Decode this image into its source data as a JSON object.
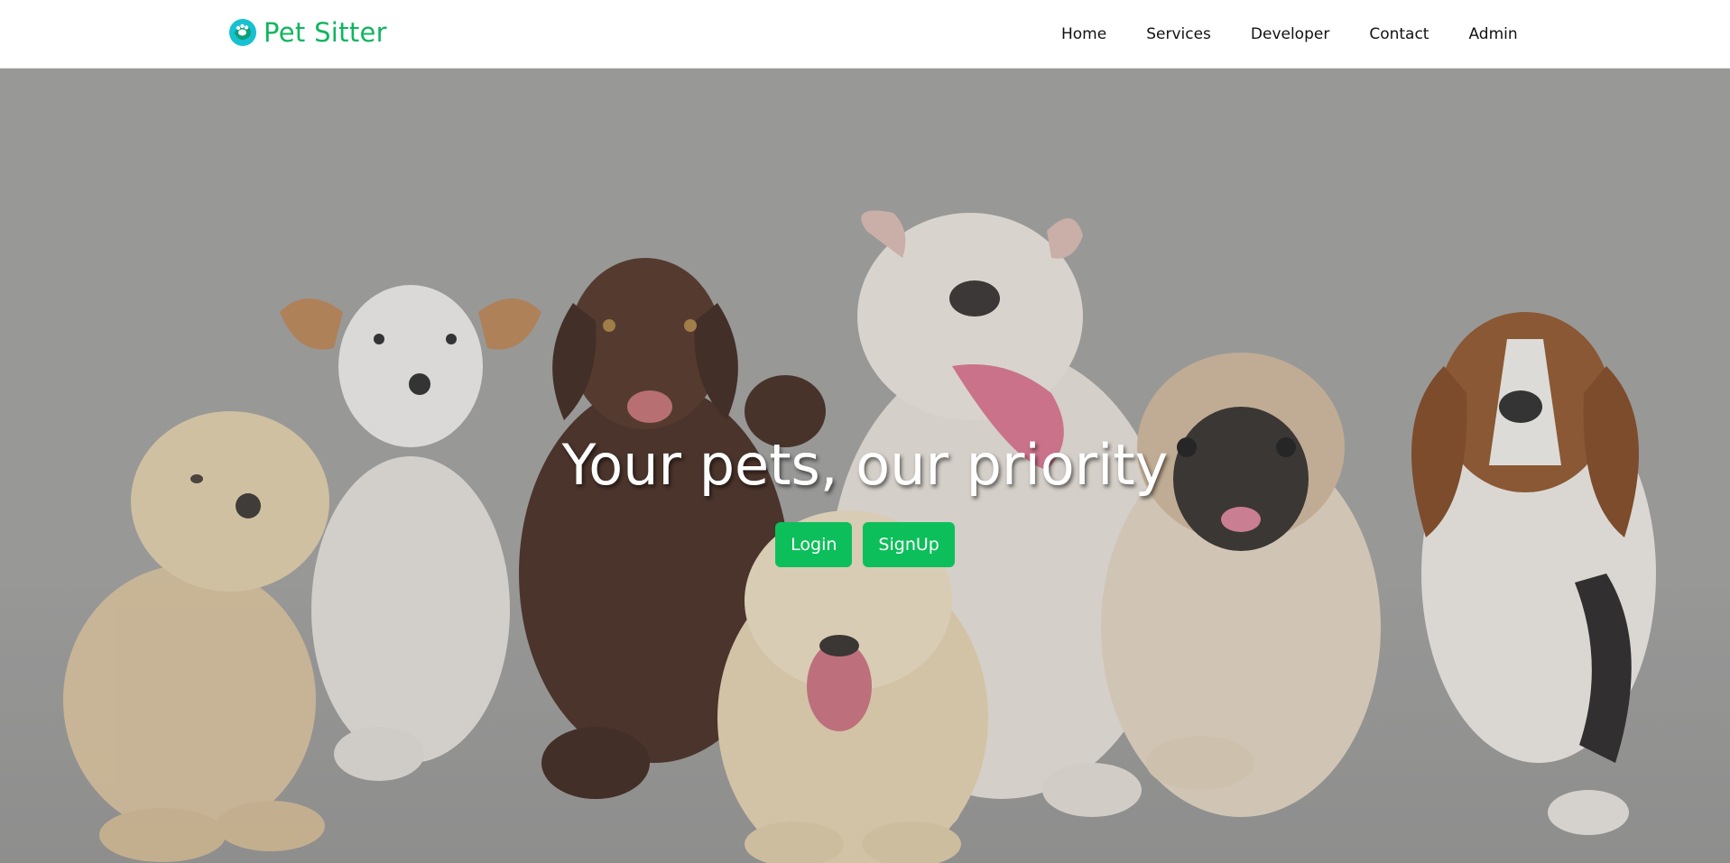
{
  "brand": {
    "name": "Pet Sitter",
    "icon": "paw-heart-icon",
    "color": "#0fb65e"
  },
  "nav": {
    "items": [
      {
        "label": "Home"
      },
      {
        "label": "Services"
      },
      {
        "label": "Developer"
      },
      {
        "label": "Contact"
      },
      {
        "label": "Admin"
      }
    ]
  },
  "hero": {
    "title": "Your pets, our priority",
    "login_label": "Login",
    "signup_label": "SignUp",
    "button_color": "#0dbf5a",
    "image": "group-of-puppies-photo"
  }
}
